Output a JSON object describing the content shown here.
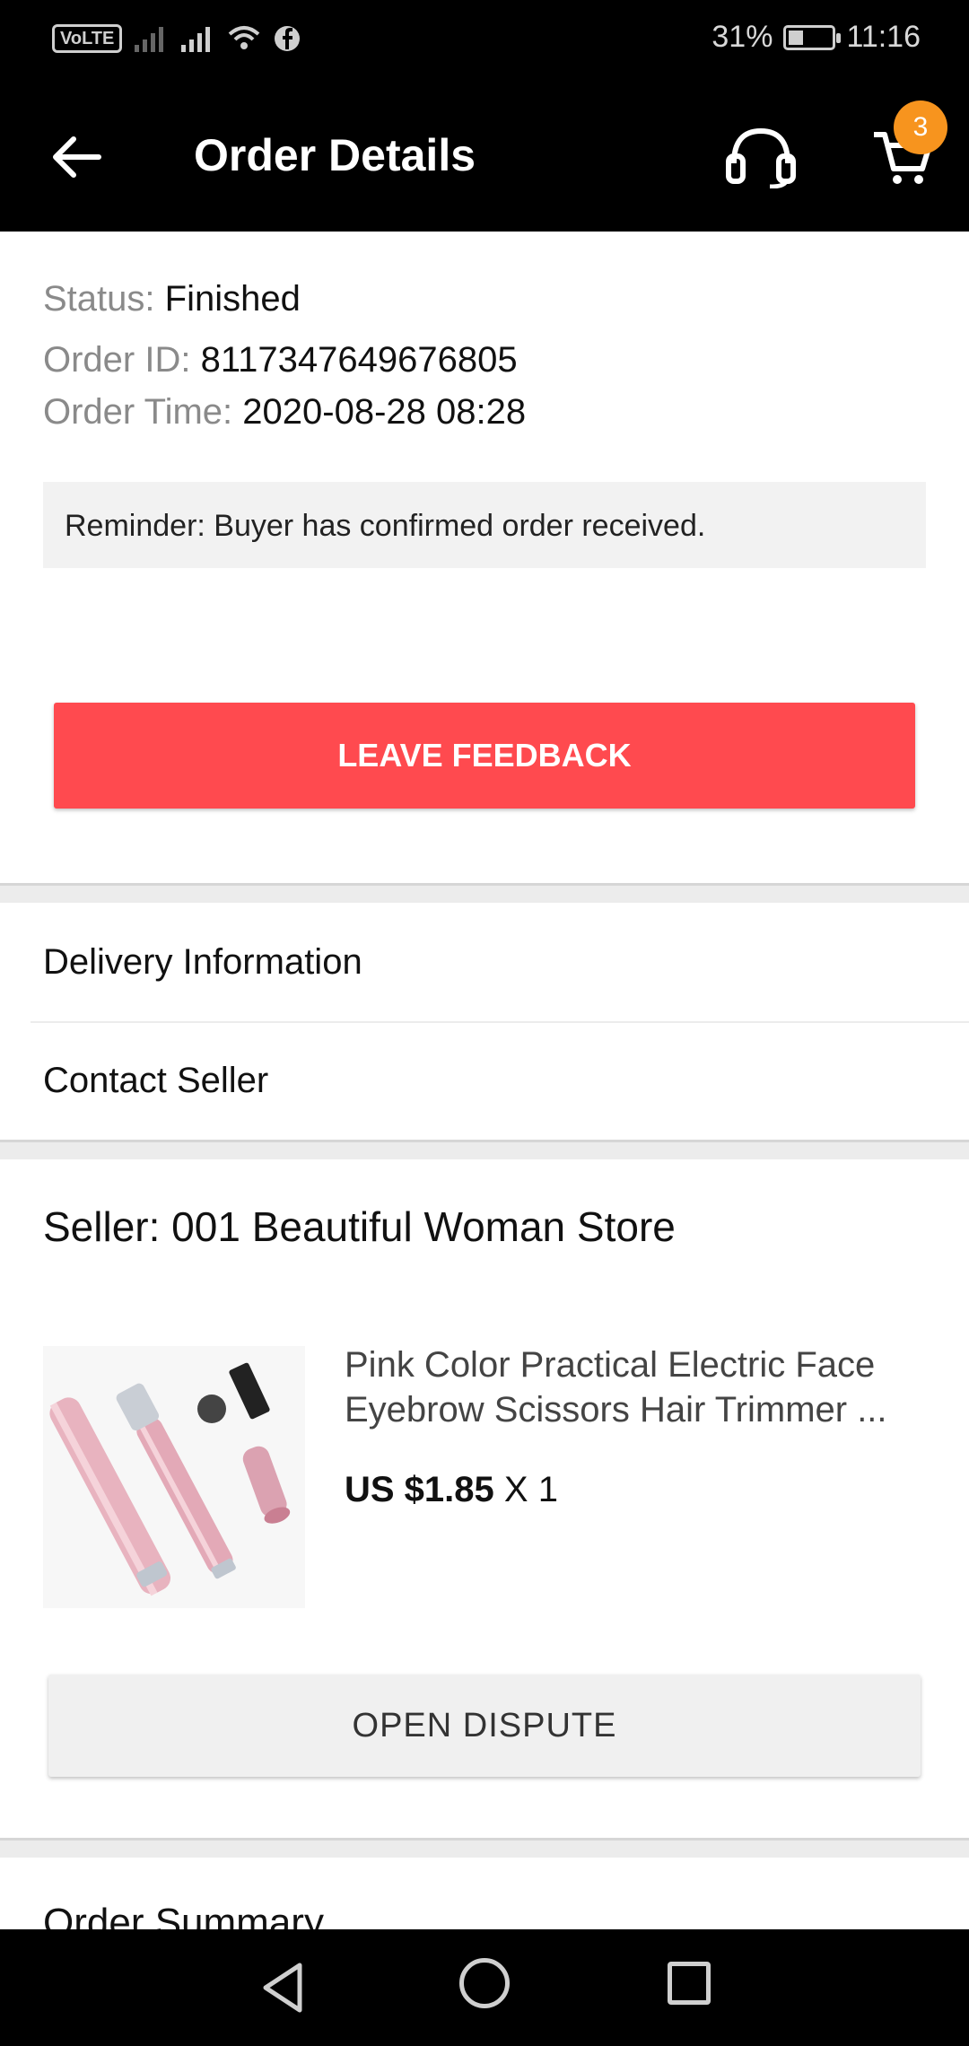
{
  "status_bar": {
    "network_badge": "VoLTE",
    "battery_percent": "31%",
    "time": "11:16"
  },
  "header": {
    "title": "Order Details",
    "cart_count": "3"
  },
  "order": {
    "status_label": "Status:",
    "status_value": "Finished",
    "id_label": "Order ID:",
    "id_value": "8117347649676805",
    "time_label": "Order Time:",
    "time_value": "2020-08-28 08:28",
    "reminder": "Reminder: Buyer has confirmed order received.",
    "feedback_button": "LEAVE FEEDBACK"
  },
  "links": {
    "delivery": "Delivery Information",
    "contact": "Contact Seller"
  },
  "product": {
    "seller": "Seller: 001 Beautiful Woman Store",
    "title": "Pink Color Practical Electric Face Eyebrow Scissors Hair Trimmer ...",
    "price": "US $1.85",
    "quantity": "X 1",
    "dispute_button": "OPEN DISPUTE"
  },
  "summary": {
    "title": "Order Summary"
  },
  "icons": {
    "back": "arrow-left-icon",
    "support": "headset-icon",
    "cart": "cart-icon"
  },
  "colors": {
    "accent": "#ff4a4f",
    "badge": "#f7941e",
    "bar": "#000000"
  }
}
